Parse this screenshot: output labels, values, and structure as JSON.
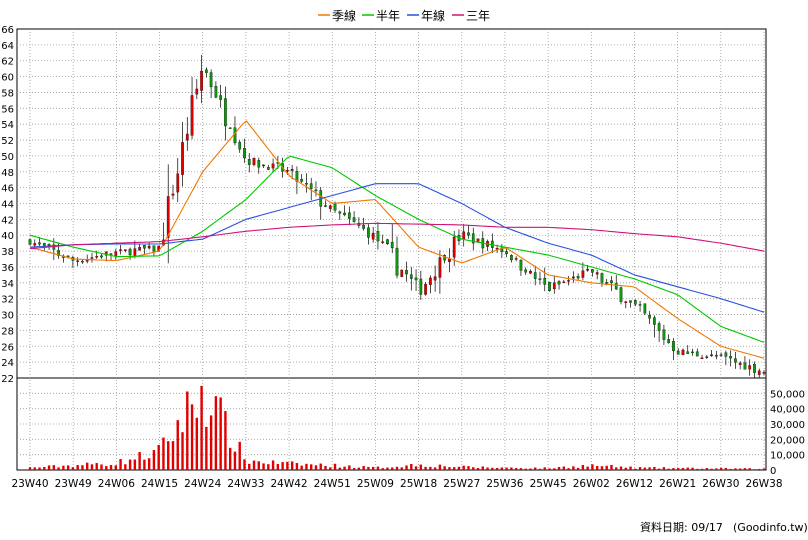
{
  "legend": [
    {
      "label": "季線",
      "color": "#f07800"
    },
    {
      "label": "半年",
      "color": "#00c800"
    },
    {
      "label": "年線",
      "color": "#2850e0"
    },
    {
      "label": "三年",
      "color": "#d01478"
    }
  ],
  "footer": {
    "date_label": "資料日期: 09/17",
    "source": "(Goodinfo.tw)"
  },
  "colors": {
    "up": "#e00000",
    "down": "#0a9a0a",
    "volume": "#e00000",
    "grid": "#9a9a9a"
  },
  "chart_data": {
    "type": "candlestick",
    "price_axis": {
      "min": 22,
      "max": 66,
      "ticks": [
        22,
        24,
        26,
        28,
        30,
        32,
        34,
        36,
        38,
        40,
        42,
        44,
        46,
        48,
        50,
        52,
        54,
        56,
        58,
        60,
        62,
        64,
        66
      ]
    },
    "volume_axis": {
      "min": 0,
      "max": 60000,
      "tick_labels": [
        "0",
        "10,000",
        "20,000",
        "30,000",
        "40,000",
        "50,000"
      ],
      "tick_values": [
        0,
        10000,
        20000,
        30000,
        40000,
        50000
      ]
    },
    "x_ticks": [
      "23W40",
      "23W49",
      "24W06",
      "24W15",
      "24W24",
      "24W33",
      "24W42",
      "24W51",
      "25W09",
      "25W18",
      "25W27",
      "25W36",
      "25W45",
      "26W02",
      "26W12",
      "26W21",
      "26W30",
      "26W38"
    ],
    "key_points": [
      {
        "label": "23W40",
        "close": 39.2
      },
      {
        "label": "23W49",
        "close": 36.8
      },
      {
        "label": "24W06",
        "close": 37.8
      },
      {
        "label": "24W15",
        "close": 38.4
      },
      {
        "label": "24W24",
        "close": 61.5
      },
      {
        "label": "24W33",
        "close": 49.5
      },
      {
        "label": "24W42",
        "close": 48.0
      },
      {
        "label": "24W51",
        "close": 43.0
      },
      {
        "label": "25W09",
        "close": 39.8
      },
      {
        "label": "25W18",
        "close": 33.0
      },
      {
        "label": "25W27",
        "close": 40.0
      },
      {
        "label": "25W36",
        "close": 38.0
      },
      {
        "label": "25W45",
        "close": 33.2
      },
      {
        "label": "26W02",
        "close": 35.5
      },
      {
        "label": "26W12",
        "close": 31.0
      },
      {
        "label": "26W21",
        "close": 25.3
      },
      {
        "label": "26W30",
        "close": 24.6
      },
      {
        "label": "26W38",
        "close": 22.8
      }
    ],
    "ma_lines": [
      {
        "name": "季線",
        "color": "#f07800",
        "values": [
          {
            "label": "23W40",
            "v": 38.5
          },
          {
            "label": "23W49",
            "v": 37.0
          },
          {
            "label": "24W06",
            "v": 36.8
          },
          {
            "label": "24W15",
            "v": 38.0
          },
          {
            "label": "24W24",
            "v": 48.0
          },
          {
            "label": "24W33",
            "v": 54.5
          },
          {
            "label": "24W42",
            "v": 47.5
          },
          {
            "label": "24W51",
            "v": 44.0
          },
          {
            "label": "25W09",
            "v": 44.5
          },
          {
            "label": "25W18",
            "v": 38.5
          },
          {
            "label": "25W27",
            "v": 36.5
          },
          {
            "label": "25W36",
            "v": 38.5
          },
          {
            "label": "25W45",
            "v": 35.0
          },
          {
            "label": "26W02",
            "v": 34.0
          },
          {
            "label": "26W12",
            "v": 33.5
          },
          {
            "label": "26W21",
            "v": 29.5
          },
          {
            "label": "26W30",
            "v": 26.0
          },
          {
            "label": "26W38",
            "v": 24.5
          }
        ]
      },
      {
        "name": "半年",
        "color": "#00c800",
        "values": [
          {
            "label": "23W40",
            "v": 40.0
          },
          {
            "label": "23W49",
            "v": 38.5
          },
          {
            "label": "24W06",
            "v": 37.3
          },
          {
            "label": "24W15",
            "v": 37.4
          },
          {
            "label": "24W24",
            "v": 40.5
          },
          {
            "label": "24W33",
            "v": 44.5
          },
          {
            "label": "24W42",
            "v": 50.0
          },
          {
            "label": "24W51",
            "v": 48.5
          },
          {
            "label": "25W09",
            "v": 45.0
          },
          {
            "label": "25W18",
            "v": 42.0
          },
          {
            "label": "25W27",
            "v": 39.5
          },
          {
            "label": "25W36",
            "v": 38.5
          },
          {
            "label": "25W45",
            "v": 37.5
          },
          {
            "label": "26W02",
            "v": 36.0
          },
          {
            "label": "26W12",
            "v": 34.5
          },
          {
            "label": "26W21",
            "v": 32.5
          },
          {
            "label": "26W30",
            "v": 28.5
          },
          {
            "label": "26W38",
            "v": 26.5
          }
        ]
      },
      {
        "name": "年線",
        "color": "#2850e0",
        "values": [
          {
            "label": "23W40",
            "v": 38.5
          },
          {
            "label": "23W49",
            "v": 38.8
          },
          {
            "label": "24W06",
            "v": 38.9
          },
          {
            "label": "24W15",
            "v": 38.9
          },
          {
            "label": "24W24",
            "v": 39.5
          },
          {
            "label": "24W33",
            "v": 42.0
          },
          {
            "label": "24W42",
            "v": 43.5
          },
          {
            "label": "24W51",
            "v": 45.0
          },
          {
            "label": "25W09",
            "v": 46.5
          },
          {
            "label": "25W18",
            "v": 46.5
          },
          {
            "label": "25W27",
            "v": 44.0
          },
          {
            "label": "25W36",
            "v": 41.0
          },
          {
            "label": "25W45",
            "v": 39.0
          },
          {
            "label": "26W02",
            "v": 37.5
          },
          {
            "label": "26W12",
            "v": 35.0
          },
          {
            "label": "26W21",
            "v": 33.5
          },
          {
            "label": "26W30",
            "v": 32.0
          },
          {
            "label": "26W38",
            "v": 30.3
          }
        ]
      },
      {
        "name": "三年",
        "color": "#d01478",
        "values": [
          {
            "label": "23W40",
            "v": 38.3
          },
          {
            "label": "23W49",
            "v": 38.8
          },
          {
            "label": "24W06",
            "v": 39.0
          },
          {
            "label": "24W15",
            "v": 39.2
          },
          {
            "label": "24W24",
            "v": 39.8
          },
          {
            "label": "24W33",
            "v": 40.5
          },
          {
            "label": "24W42",
            "v": 41.0
          },
          {
            "label": "24W51",
            "v": 41.3
          },
          {
            "label": "25W09",
            "v": 41.5
          },
          {
            "label": "25W18",
            "v": 41.4
          },
          {
            "label": "25W27",
            "v": 41.3
          },
          {
            "label": "25W36",
            "v": 41.0
          },
          {
            "label": "25W45",
            "v": 41.0
          },
          {
            "label": "26W02",
            "v": 40.7
          },
          {
            "label": "26W12",
            "v": 40.2
          },
          {
            "label": "26W21",
            "v": 39.8
          },
          {
            "label": "26W30",
            "v": 39.0
          },
          {
            "label": "26W38",
            "v": 38.0
          }
        ]
      }
    ],
    "volume_key_points": [
      {
        "label": "23W40",
        "v": 1500
      },
      {
        "label": "24W06",
        "v": 4500
      },
      {
        "label": "24W15",
        "v": 12000
      },
      {
        "label": "24W24",
        "v": 53000
      },
      {
        "label": "24W33",
        "v": 6000
      },
      {
        "label": "24W42",
        "v": 4000
      },
      {
        "label": "24W51",
        "v": 3000
      },
      {
        "label": "25W09",
        "v": 1500
      },
      {
        "label": "25W18",
        "v": 3500
      },
      {
        "label": "25W27",
        "v": 2000
      },
      {
        "label": "25W36",
        "v": 1500
      },
      {
        "label": "25W45",
        "v": 1200
      },
      {
        "label": "26W02",
        "v": 3000
      },
      {
        "label": "26W12",
        "v": 1500
      },
      {
        "label": "26W21",
        "v": 1200
      },
      {
        "label": "26W30",
        "v": 1000
      },
      {
        "label": "26W38",
        "v": 800
      }
    ]
  }
}
